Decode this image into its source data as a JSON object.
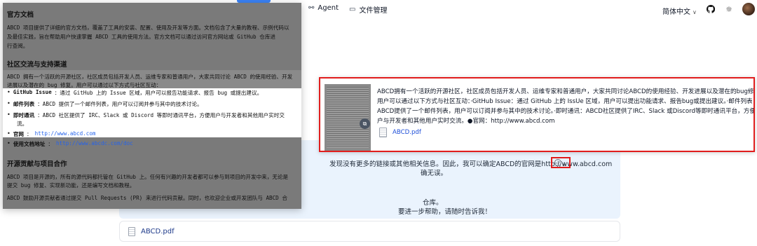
{
  "topbar": {
    "agent_label": "Agent",
    "files_label": "文件管理",
    "language": "简体中文",
    "language_chevron": "∨"
  },
  "doc_preview": {
    "heading1": "官方文档",
    "para1": [
      "ABCD 项目提供了详细的官方文档，覆盖了工具的安装、配置、使用及开发等方面。文档包含了大量的教程、示例代码以",
      "及最佳实践，旨在帮助用户快速掌握 ABCD 工具的使用方法。官方文档可以通过访问官方网站或 GitHub 仓库进",
      "行查阅。"
    ],
    "heading2": "社区交流与支持渠道",
    "para2": [
      "ABCD 拥有一个活跃的开源社区，社区成员包括开发人员、运维专家和普通用户，大家共同讨论 ABCD 的使用经验、开发",
      "进展以及潜在的 bug 修复。用户可以通过以下方式与社区互动："
    ],
    "bullets": [
      {
        "term": "GitHub Issue",
        "text": "：通过 GitHub 上的 Issue 区域，用户可以报告功能请求、报告 bug 或提出建议。"
      },
      {
        "term": "邮件列表",
        "text": "：ABCD 提供了一个邮件列表，用户可以订阅并参与其中的技术讨论。"
      },
      {
        "term": "即时通讯",
        "text": "：ABCD 社区提供了 IRC、Slack 或 Discord 等即时通讯平台，方便用户与开发者和其他用户实时交"
      },
      {
        "term": "",
        "text": "流。"
      },
      {
        "term": "官网",
        "text": "：",
        "link": "http://www.abcd.com"
      },
      {
        "term": "使用文档地址",
        "text": "：",
        "link": "http://www.abcdc.com/doc"
      }
    ],
    "heading3": "开源贡献与项目合作",
    "para3": [
      "ABCD 项目是开源的，所有的源代码都托管在 GitHub 上。任何有兴趣的开发者都可以参与到项目的开发中来，无论是",
      "提交 bug 修复、实现新功能，还是编写文档和教程。",
      "",
      "ABCD 鼓励开源贡献者通过提交 Pull Requests (PR) 来进行代码贡献。同时，也欢迎企业或开发团队与 ABCD 合"
    ]
  },
  "callout": {
    "lines": [
      "ABCD拥有一个活跃的开源社区，社区成员包括开发人员、运维专家和普通用户，大家共同讨论ABCD的使用经验、开发进展以及潜在的bug修复，",
      "用户可以通过以下方式与社区互动：·GitHub Issue：通过 GitHub 上的 IssUe 区域，用户可以提出功能请求、报告bug或提出建议。·邮件列表：",
      "ABCD提供了一个邮件列表，用户可以订阅并参与其中的技术讨论。·即时通讯：ABCD社区提供了IRC、Slack 或Discord等即时通讯平台，方便用",
      "户与开发者和其他用户实时交流。●官网：http://www.abcd.com"
    ],
    "file_name": "ABCD.pdf"
  },
  "answer": {
    "line1": "发现没有更多的链接或其他相关信息。因此，我可以确定ABCD的官网是http://www.abcd.com",
    "line1_end": "。",
    "line2": "确无误。",
    "line3": "仓库。",
    "line4": "要进一步帮助，请随时告诉我！"
  },
  "attachment": {
    "file_name": "ABCD.pdf"
  },
  "colors": {
    "highlight_border": "#e11d1d",
    "accent": "#3b82f6",
    "bubble": "#eaf3fd"
  }
}
